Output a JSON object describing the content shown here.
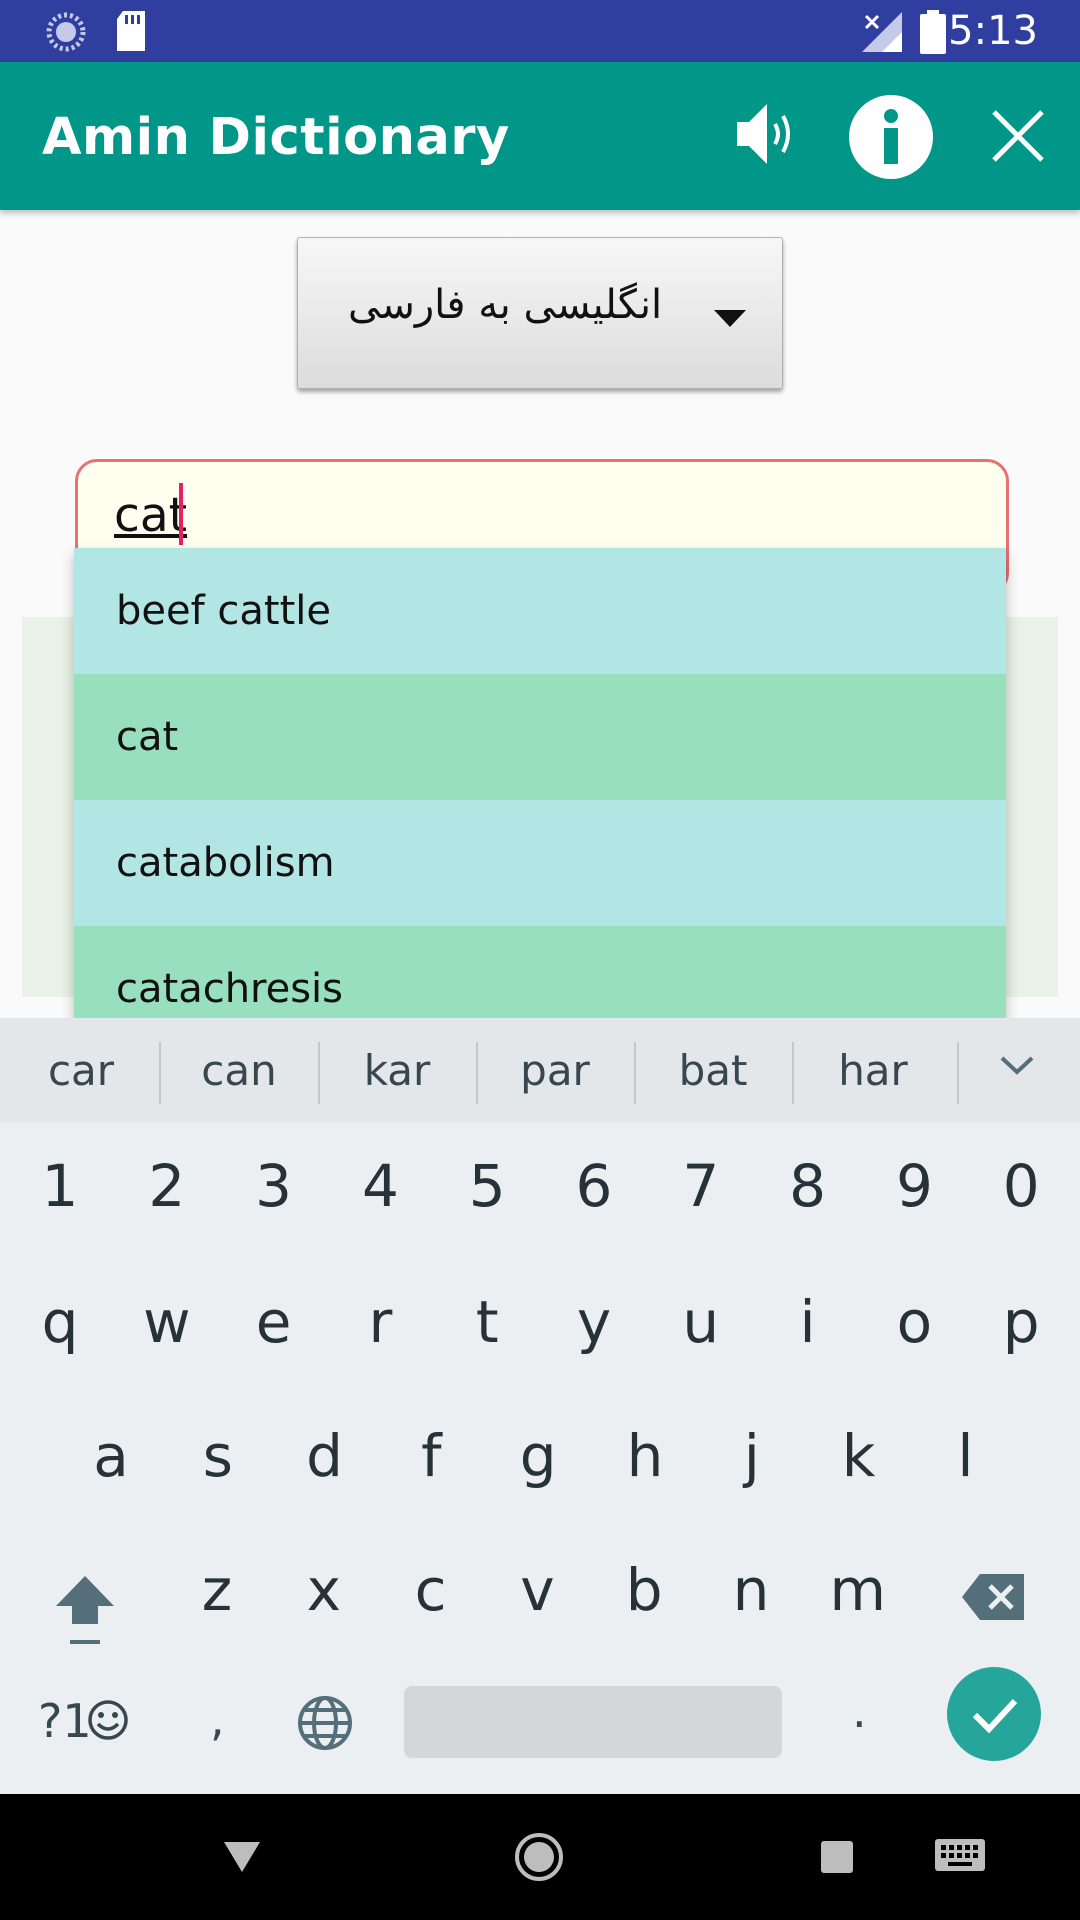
{
  "status_bar": {
    "time": "5:13"
  },
  "app_bar": {
    "title": "Amin Dictionary",
    "icons": [
      "speaker-icon",
      "info-icon",
      "close-icon"
    ],
    "color": "#009688"
  },
  "language_spinner": {
    "selected": "انگلیسی به فارسی"
  },
  "search": {
    "value": "cat"
  },
  "suggestions": [
    {
      "label": "beef cattle",
      "color": "#b2e6e4"
    },
    {
      "label": "cat",
      "color": "#98dfbe"
    },
    {
      "label": "catabolism",
      "color": "#b2e6e4"
    },
    {
      "label": "catachresis",
      "color": "#98dfbe"
    }
  ],
  "keyboard": {
    "suggestions": [
      "car",
      "can",
      "kar",
      "par",
      "bat",
      "har"
    ],
    "row_numbers": [
      "1",
      "2",
      "3",
      "4",
      "5",
      "6",
      "7",
      "8",
      "9",
      "0"
    ],
    "row1": [
      "q",
      "w",
      "e",
      "r",
      "t",
      "y",
      "u",
      "i",
      "o",
      "p"
    ],
    "row2": [
      "a",
      "s",
      "d",
      "f",
      "g",
      "h",
      "j",
      "k",
      "l"
    ],
    "row3": [
      "z",
      "x",
      "c",
      "v",
      "b",
      "n",
      "m"
    ],
    "symbols_label": "?1",
    "comma": ",",
    "period": "."
  }
}
